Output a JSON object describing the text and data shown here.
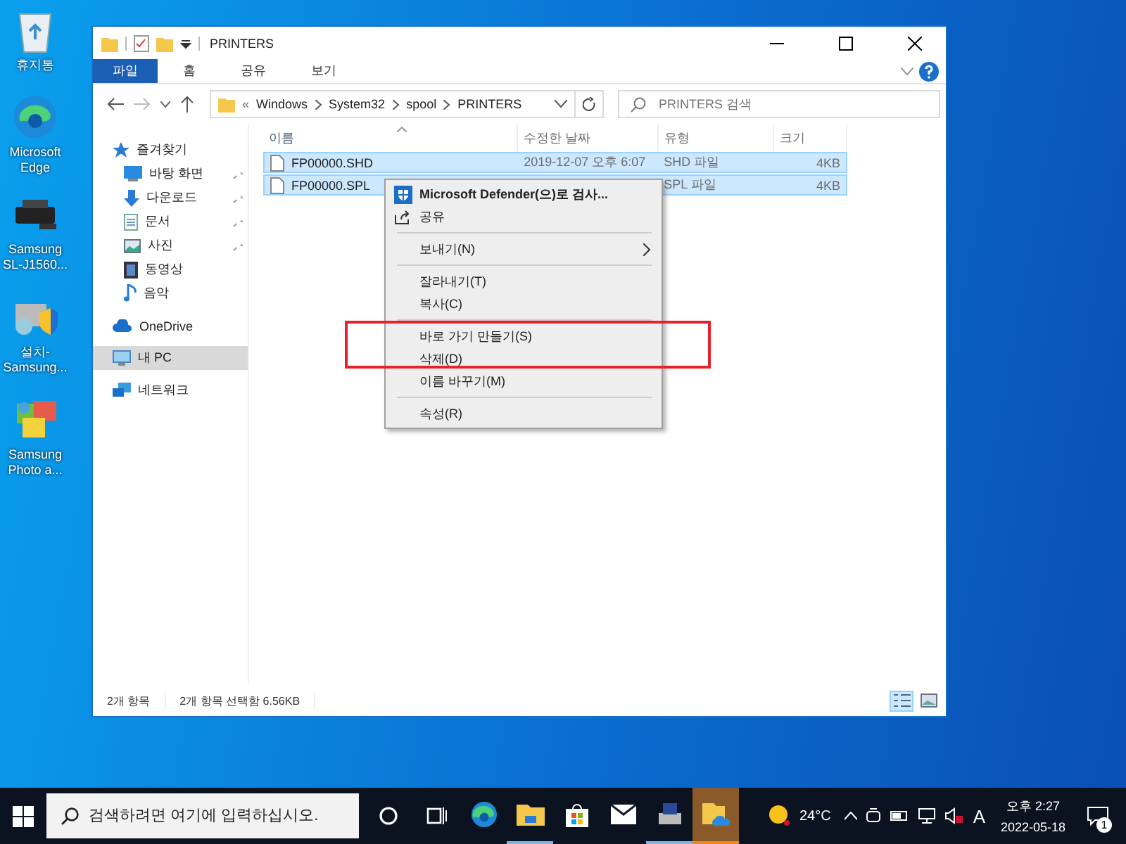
{
  "desktop_icons": [
    {
      "label": "휴지통",
      "kind": "bin"
    },
    {
      "label": "Microsoft Edge",
      "kind": "edge"
    },
    {
      "label": "Samsung SL-J1560...",
      "kind": "printer"
    },
    {
      "label": "설치-Samsung...",
      "kind": "setup"
    },
    {
      "label": "Samsung Photo a...",
      "kind": "photo"
    }
  ],
  "window": {
    "title": "PRINTERS"
  },
  "ribbon_tabs": [
    {
      "label": "파일",
      "selected": true
    },
    {
      "label": "홈",
      "selected": false
    },
    {
      "label": "공유",
      "selected": false
    },
    {
      "label": "보기",
      "selected": false
    }
  ],
  "address": {
    "prefix": "«",
    "crumbs": [
      "Windows",
      "System32",
      "spool",
      "PRINTERS"
    ]
  },
  "search": {
    "placeholder": "PRINTERS 검색"
  },
  "nav": [
    {
      "label": "즐겨찾기",
      "kind": "star",
      "selected": false,
      "children": [
        {
          "label": "바탕 화면",
          "kind": "desktop",
          "pinned": true,
          "selected": false
        },
        {
          "label": "다운로드",
          "kind": "download",
          "pinned": true,
          "selected": false
        },
        {
          "label": "문서",
          "kind": "docs",
          "pinned": true,
          "selected": false
        },
        {
          "label": "사진",
          "kind": "pictures",
          "pinned": true,
          "selected": false
        },
        {
          "label": "동영상",
          "kind": "videos",
          "pinned": false,
          "selected": false
        },
        {
          "label": "음악",
          "kind": "music",
          "pinned": false,
          "selected": false
        }
      ]
    },
    {
      "label": "OneDrive",
      "kind": "cloud",
      "selected": false
    },
    {
      "label": "내 PC",
      "kind": "pc",
      "selected": true
    },
    {
      "label": "네트워크",
      "kind": "network",
      "selected": false
    }
  ],
  "table": {
    "columns": [
      "이름",
      "수정한 날짜",
      "유형",
      "크기"
    ],
    "rows": [
      {
        "name": "FP00000.SHD",
        "modified": "2019-12-07 오후 6:07",
        "type": "SHD 파일",
        "size": "4KB",
        "selected": true
      },
      {
        "name": "FP00000.SPL",
        "type": "SPL 파일",
        "size": "4KB",
        "selected": true
      }
    ]
  },
  "context_menu": [
    [
      {
        "label": "Microsoft Defender(으)로 검사...",
        "kind": "scan"
      },
      {
        "label": "공유",
        "kind": "share"
      }
    ],
    [
      {
        "label": "보내기(N)",
        "kind": "submenu"
      }
    ],
    [
      {
        "label": "잘라내기(T)",
        "kind": "plain"
      },
      {
        "label": "복사(C)",
        "kind": "plain"
      }
    ],
    [
      {
        "label": "바로 가기 만들기(S)",
        "kind": "plain"
      },
      {
        "label": "삭제(D)",
        "kind": "plain"
      },
      {
        "label": "이름 바꾸기(M)",
        "kind": "plain"
      }
    ],
    [
      {
        "label": "속성(R)",
        "kind": "plain"
      }
    ]
  ],
  "status_bar": {
    "count": "2개 항목",
    "selection": "2개 항목 선택함 6.56KB"
  },
  "taskbar": {
    "search_placeholder": "검색하려면 여기에 입력하십시오.",
    "apps": [
      {
        "kind": "edge",
        "running": false,
        "selected": false
      },
      {
        "kind": "folder",
        "running": true,
        "selected": false
      },
      {
        "kind": "store",
        "running": false,
        "selected": false
      },
      {
        "kind": "mail",
        "running": false,
        "selected": false
      },
      {
        "kind": "printer",
        "running": true,
        "selected": false
      },
      {
        "kind": "onedrive-folder",
        "running": true,
        "selected": true
      }
    ],
    "temperature": "24°C",
    "ime": "A",
    "time": "오후 2:27",
    "date": "2022-05-18",
    "notifications": "1"
  }
}
